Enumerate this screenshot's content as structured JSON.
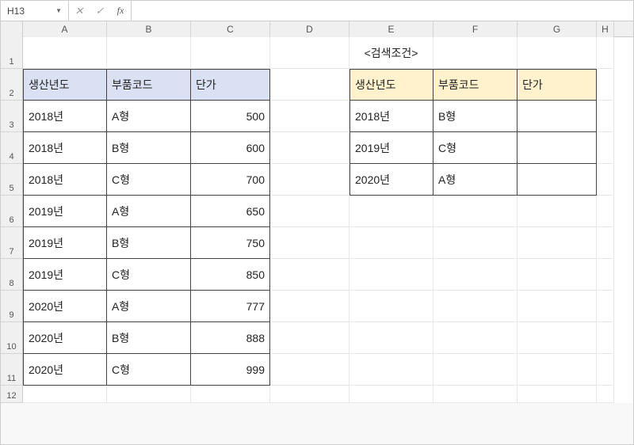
{
  "nameBox": "H13",
  "formula": "",
  "columns": [
    "A",
    "B",
    "C",
    "D",
    "E",
    "F",
    "G",
    "H"
  ],
  "row1": {
    "E": "<검색조건>"
  },
  "headersLeft": {
    "A": "생산년도",
    "B": "부품코드",
    "C": "단가"
  },
  "headersRight": {
    "E": "생산년도",
    "F": "부품코드",
    "G": "단가"
  },
  "leftData": [
    {
      "year": "2018년",
      "code": "A형",
      "price": "500"
    },
    {
      "year": "2018년",
      "code": "B형",
      "price": "600"
    },
    {
      "year": "2018년",
      "code": "C형",
      "price": "700"
    },
    {
      "year": "2019년",
      "code": "A형",
      "price": "650"
    },
    {
      "year": "2019년",
      "code": "B형",
      "price": "750"
    },
    {
      "year": "2019년",
      "code": "C형",
      "price": "850"
    },
    {
      "year": "2020년",
      "code": "A형",
      "price": "777"
    },
    {
      "year": "2020년",
      "code": "B형",
      "price": "888"
    },
    {
      "year": "2020년",
      "code": "C형",
      "price": "999"
    }
  ],
  "rightData": [
    {
      "year": "2018년",
      "code": "B형",
      "price": ""
    },
    {
      "year": "2019년",
      "code": "C형",
      "price": ""
    },
    {
      "year": "2020년",
      "code": "A형",
      "price": ""
    }
  ]
}
